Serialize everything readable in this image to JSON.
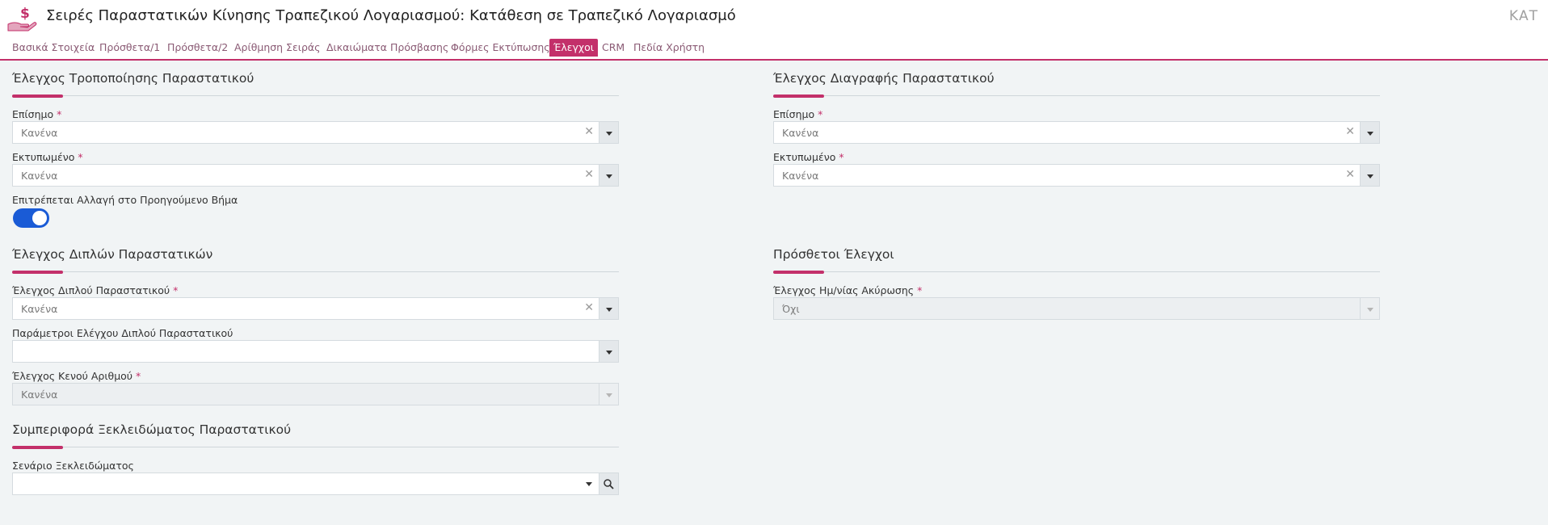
{
  "header": {
    "title": "Σειρές Παραστατικών Κίνησης Τραπεζικού Λογαριασμού: Κατάθεση σε Τραπεζικό Λογαριασμό",
    "right_text": "ΚΑΤ",
    "logo_icon": "hand-dollar-icon"
  },
  "tabs": [
    {
      "label": "Βασικά Στοιχεία"
    },
    {
      "label": "Πρόσθετα/1"
    },
    {
      "label": "Πρόσθετα/2"
    },
    {
      "label": "Αρίθμηση Σειράς"
    },
    {
      "label": "Δικαιώματα Πρόσβασης"
    },
    {
      "label": "Φόρμες Εκτύπωσης"
    },
    {
      "label": "Έλεγχοι",
      "active": true
    },
    {
      "label": "CRM"
    },
    {
      "label": "Πεδία Χρήστη"
    }
  ],
  "colors": {
    "accent": "#c3306a",
    "toggle_on": "#1a5bd6",
    "background": "#f1f4f5"
  },
  "required_marker": "*",
  "modification": {
    "title": "Έλεγχος Τροποποίησης Παραστατικού",
    "official": {
      "label": "Επίσημο",
      "value": "Κανένα"
    },
    "printed": {
      "label": "Εκτυπωμένο",
      "value": "Κανένα"
    },
    "allow_prev_step": {
      "label": "Επιτρέπεται Αλλαγή στο Προηγούμενο Βήμα",
      "on": true
    }
  },
  "deletion": {
    "title": "Έλεγχος Διαγραφής Παραστατικού",
    "official": {
      "label": "Επίσημο",
      "value": "Κανένα"
    },
    "printed": {
      "label": "Εκτυπωμένο",
      "value": "Κανένα"
    }
  },
  "duplicates": {
    "title": "Έλεγχος Διπλών Παραστατικών",
    "duplicate_check": {
      "label": "Έλεγχος Διπλού Παραστατικού",
      "value": "Κανένα"
    },
    "duplicate_params": {
      "label": "Παράμετροι Ελέγχου Διπλού Παραστατικού",
      "value": ""
    },
    "gap_check": {
      "label": "Έλεγχος Κενού Αριθμού",
      "value": "Κανένα"
    }
  },
  "additional": {
    "title": "Πρόσθετοι Έλεγχοι",
    "cancel_date_check": {
      "label": "Έλεγχος Ημ/νίας Ακύρωσης",
      "value": "Όχι"
    }
  },
  "unlock": {
    "title": "Συμπεριφορά Ξεκλειδώματος Παραστατικού",
    "scenario": {
      "label": "Σενάριο Ξεκλειδώματος",
      "value": ""
    }
  }
}
